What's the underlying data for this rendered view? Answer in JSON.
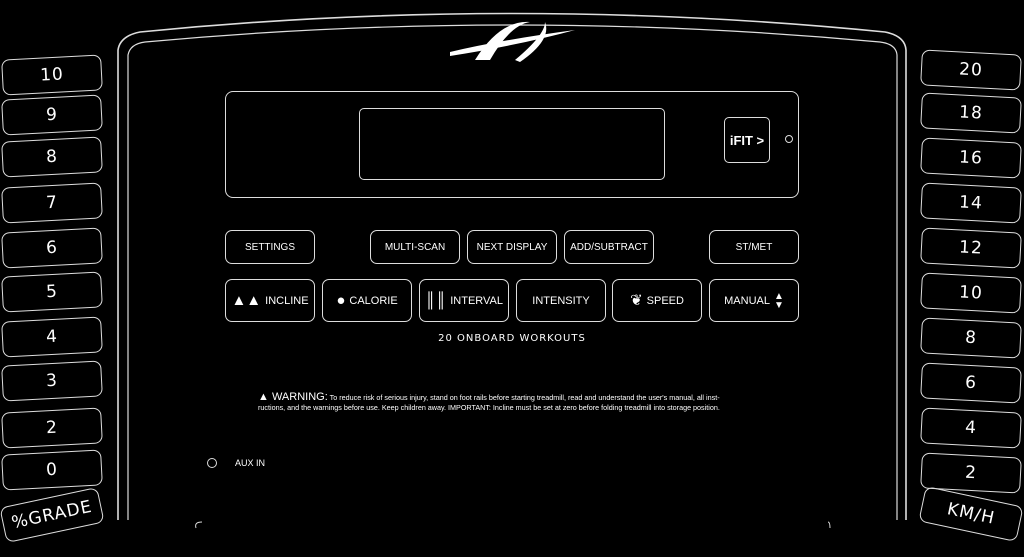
{
  "incline_keys": [
    "10",
    "9",
    "8",
    "7",
    "6",
    "5",
    "4",
    "3",
    "2",
    "0"
  ],
  "incline_label": "%GRADE",
  "speed_keys": [
    "20",
    "18",
    "16",
    "14",
    "12",
    "10",
    "8",
    "6",
    "4",
    "2"
  ],
  "speed_label": "KM/H",
  "display": {
    "ifit_label": "iFIT >"
  },
  "row1": {
    "settings": "SETTINGS",
    "multi_scan": "MULTI-SCAN",
    "next_display": "NEXT DISPLAY",
    "add_subtract": "ADD/SUBTRACT",
    "st_met": "ST/MET"
  },
  "row2": {
    "incline": "INCLINE",
    "calorie": "CALORIE",
    "interval": "INTERVAL",
    "intensity": "INTENSITY",
    "speed": "SPEED",
    "manual": "MANUAL"
  },
  "workouts_label": "20 ONBOARD WORKOUTS",
  "warning": {
    "title": "WARNING:",
    "line1": "To reduce risk of serious injury, stand on foot rails before starting treadmill, read and understand the user's manual, all inst-",
    "line2": "ructions, and the warnings before use.  Keep children away.  IMPORTANT: Incline must be set at zero before folding treadmill into storage position."
  },
  "aux_label": "AUX IN"
}
